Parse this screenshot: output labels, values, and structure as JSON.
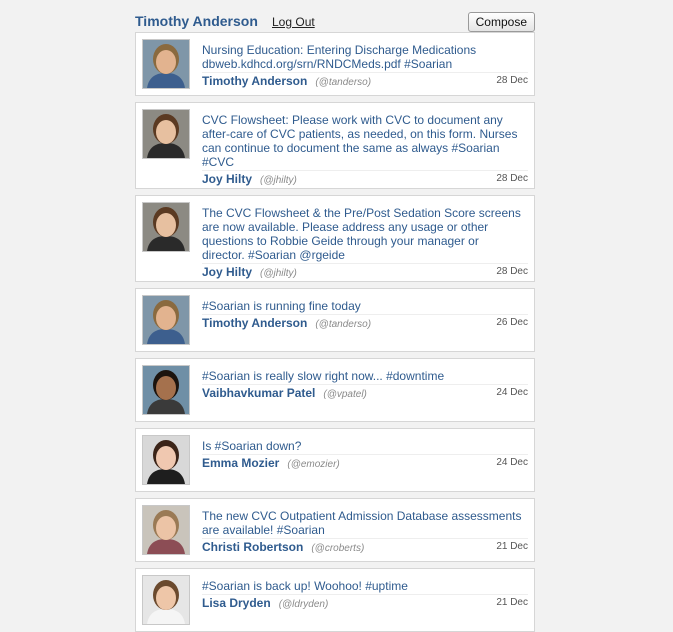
{
  "header": {
    "user_name": "Timothy Anderson",
    "logout_label": "Log Out",
    "compose_label": "Compose"
  },
  "posts": [
    {
      "lines": [
        "Nursing Education: Entering Discharge Medications",
        "dbweb.kdhcd.org/srn/RNDCMeds.pdf #Soarian"
      ],
      "author": "Timothy Anderson",
      "handle": "(@tanderso)",
      "date": "28 Dec",
      "avatar": {
        "bg": "#7f96a8",
        "skin": "#e2b38f",
        "hair": "#8a6a3f",
        "shirt": "#3d5f8e"
      }
    },
    {
      "lines": [
        "CVC Flowsheet: Please work with CVC to document any",
        "after-care of CVC patients, as needed, on this form. Nurses",
        "can continue to document the same as always #Soarian",
        "#CVC"
      ],
      "author": "Joy Hilty",
      "handle": "(@jhilty)",
      "date": "28 Dec",
      "avatar": {
        "bg": "#8c8a83",
        "skin": "#e7c0a0",
        "hair": "#5b3a22",
        "shirt": "#2a2a2a"
      }
    },
    {
      "lines": [
        "The CVC Flowsheet & the Pre/Post Sedation Score screens",
        "are now available. Please address any usage or other",
        "questions to Robbie Geide through your manager or",
        "director. #Soarian @rgeide"
      ],
      "author": "Joy Hilty",
      "handle": "(@jhilty)",
      "date": "28 Dec",
      "avatar": {
        "bg": "#8c8a83",
        "skin": "#e7c0a0",
        "hair": "#5b3a22",
        "shirt": "#2a2a2a"
      }
    },
    {
      "lines": [
        "#Soarian is running fine today"
      ],
      "author": "Timothy Anderson",
      "handle": "(@tanderso)",
      "date": "26 Dec",
      "avatar": {
        "bg": "#7f96a8",
        "skin": "#e2b38f",
        "hair": "#8a6a3f",
        "shirt": "#3d5f8e"
      }
    },
    {
      "lines": [
        "#Soarian is really slow right now... #downtime"
      ],
      "author": "Vaibhavkumar Patel",
      "handle": "(@vpatel)",
      "date": "24 Dec",
      "avatar": {
        "bg": "#6f8fa6",
        "skin": "#a5714d",
        "hair": "#1c140e",
        "shirt": "#3a3a3a"
      }
    },
    {
      "lines": [
        "Is #Soarian down?"
      ],
      "author": "Emma Mozier",
      "handle": "(@emozier)",
      "date": "24 Dec",
      "avatar": {
        "bg": "#d8d8d8",
        "skin": "#f0c8b0",
        "hair": "#3b2418",
        "shirt": "#1e1e1e"
      }
    },
    {
      "lines": [
        "The new CVC Outpatient Admission Database assessments",
        "are available! #Soarian"
      ],
      "author": "Christi Robertson",
      "handle": "(@croberts)",
      "date": "21 Dec",
      "avatar": {
        "bg": "#c9c4bb",
        "skin": "#ecc4a6",
        "hair": "#9a7a55",
        "shirt": "#8c4d55"
      }
    },
    {
      "lines": [
        "#Soarian is back up! Woohoo! #uptime"
      ],
      "author": "Lisa Dryden",
      "handle": "(@ldryden)",
      "date": "21 Dec",
      "avatar": {
        "bg": "#e6e6e6",
        "skin": "#eec6a8",
        "hair": "#6b4a2e",
        "shirt": "#f5f5f5"
      }
    }
  ]
}
